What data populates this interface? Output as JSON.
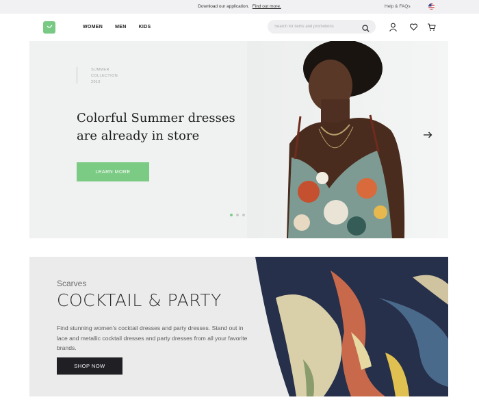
{
  "topbar": {
    "promo_text": "Download our application.",
    "promo_link": "Find out more.",
    "help": "Help & FAQs",
    "flag_icon": "us-flag-icon"
  },
  "header": {
    "logo_icon": "shopping-bag-icon",
    "nav": [
      {
        "label": "WOMEN"
      },
      {
        "label": "MEN"
      },
      {
        "label": "KIDS"
      }
    ],
    "search_placeholder": "Search for items and promotions",
    "icons": [
      "search-icon",
      "user-icon",
      "heart-icon",
      "cart-icon"
    ]
  },
  "hero": {
    "collection_lines": [
      "SUMMER",
      "COLLECTION",
      "2019"
    ],
    "title": "Colorful Summer dresses are already in store",
    "button": "LEARN MORE",
    "slide_count": 3,
    "active_slide": 1,
    "accent_color": "#7ccb84"
  },
  "scarves": {
    "category": "Scarves",
    "title": "COCKTAIL & PARTY",
    "description": "Find stunning women's cocktail dresses and party dresses. Stand out in lace and metallic cocktail dresses and party dresses from all your favorite brands.",
    "button": "SHOP NOW"
  }
}
